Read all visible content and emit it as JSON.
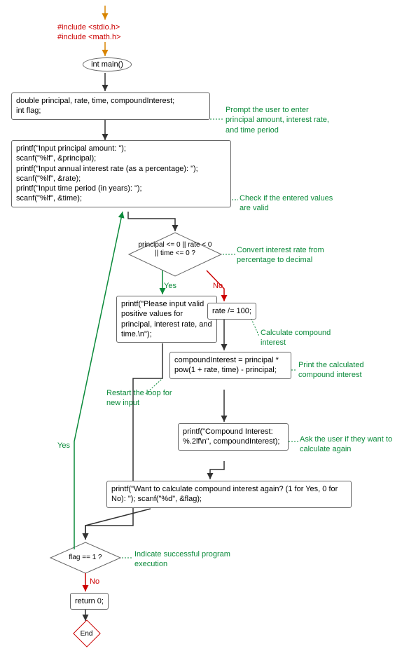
{
  "includes": [
    "#include <stdio.h>",
    "#include <math.h>"
  ],
  "funcDecl": "int main()",
  "declNode": "double principal, rate, time, compoundInterest;\nint flag;",
  "inputNode": "printf(\"Input principal amount: \");\nscanf(\"%lf\", &principal);\nprintf(\"Input annual interest rate (as a percentage): \");\nscanf(\"%lf\", &rate);\nprintf(\"Input time period (in years): \");\nscanf(\"%lf\", &time);",
  "decision1": "principal <= 0 || rate < 0 || time <= 0 ?",
  "validMsg": "printf(\"Please input valid positive values for principal, interest rate, and time.\\n\");",
  "rateConv": "rate /= 100;",
  "calcNode": "compoundInterest = principal * pow(1 + rate, time) - principal;",
  "printNode": "printf(\"Compound Interest: %.2lf\\n\", compoundInterest);",
  "askNode": "printf(\"Want to calculate compound interest again? (1 for Yes, 0 for No): \");\nscanf(\"%d\", &flag);",
  "decision2": "flag == 1 ?",
  "returnNode": "return 0;",
  "endNode": "End",
  "labels": {
    "yes": "Yes",
    "no": "No"
  },
  "comments": {
    "c1": "Prompt the user to enter principal amount, interest rate, and time period",
    "c2": "Check if the entered values are valid",
    "c3": "Convert interest rate from percentage to decimal",
    "c4": "Calculate compound interest",
    "c5": "Print the calculated compound interest",
    "c6": "Ask the user if they want to calculate again",
    "c7": "Restart the loop for new input",
    "c8": "Indicate successful program execution"
  }
}
